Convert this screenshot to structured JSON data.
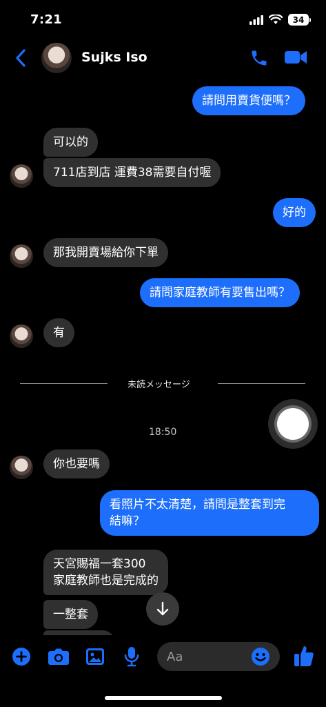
{
  "status": {
    "time": "7:21",
    "battery": "34"
  },
  "header": {
    "contact_name": "Sujks Iso"
  },
  "messages": {
    "m1": "請問用賣貨便嗎？",
    "m2": "可以的",
    "m3": "711店到店 運費38需要自付喔",
    "m4": "好的",
    "m5": "那我開賣場給你下單",
    "m6": "請問家庭教師有要售出嗎？",
    "m7": "有",
    "divider": "未読メッセージ",
    "time": "18:50",
    "m8": "你也要嗎",
    "m9_line1": "看照片不太清楚，請問是整套到完",
    "m9_line2": "結嘛？",
    "m10_line1": "天宮賜福一套300",
    "m10_line2": "家庭教師也是完成的",
    "m11": "一整套"
  },
  "composer": {
    "placeholder": "Aa"
  },
  "colors": {
    "accent": "#1d6ffb",
    "incoming": "#303030"
  }
}
